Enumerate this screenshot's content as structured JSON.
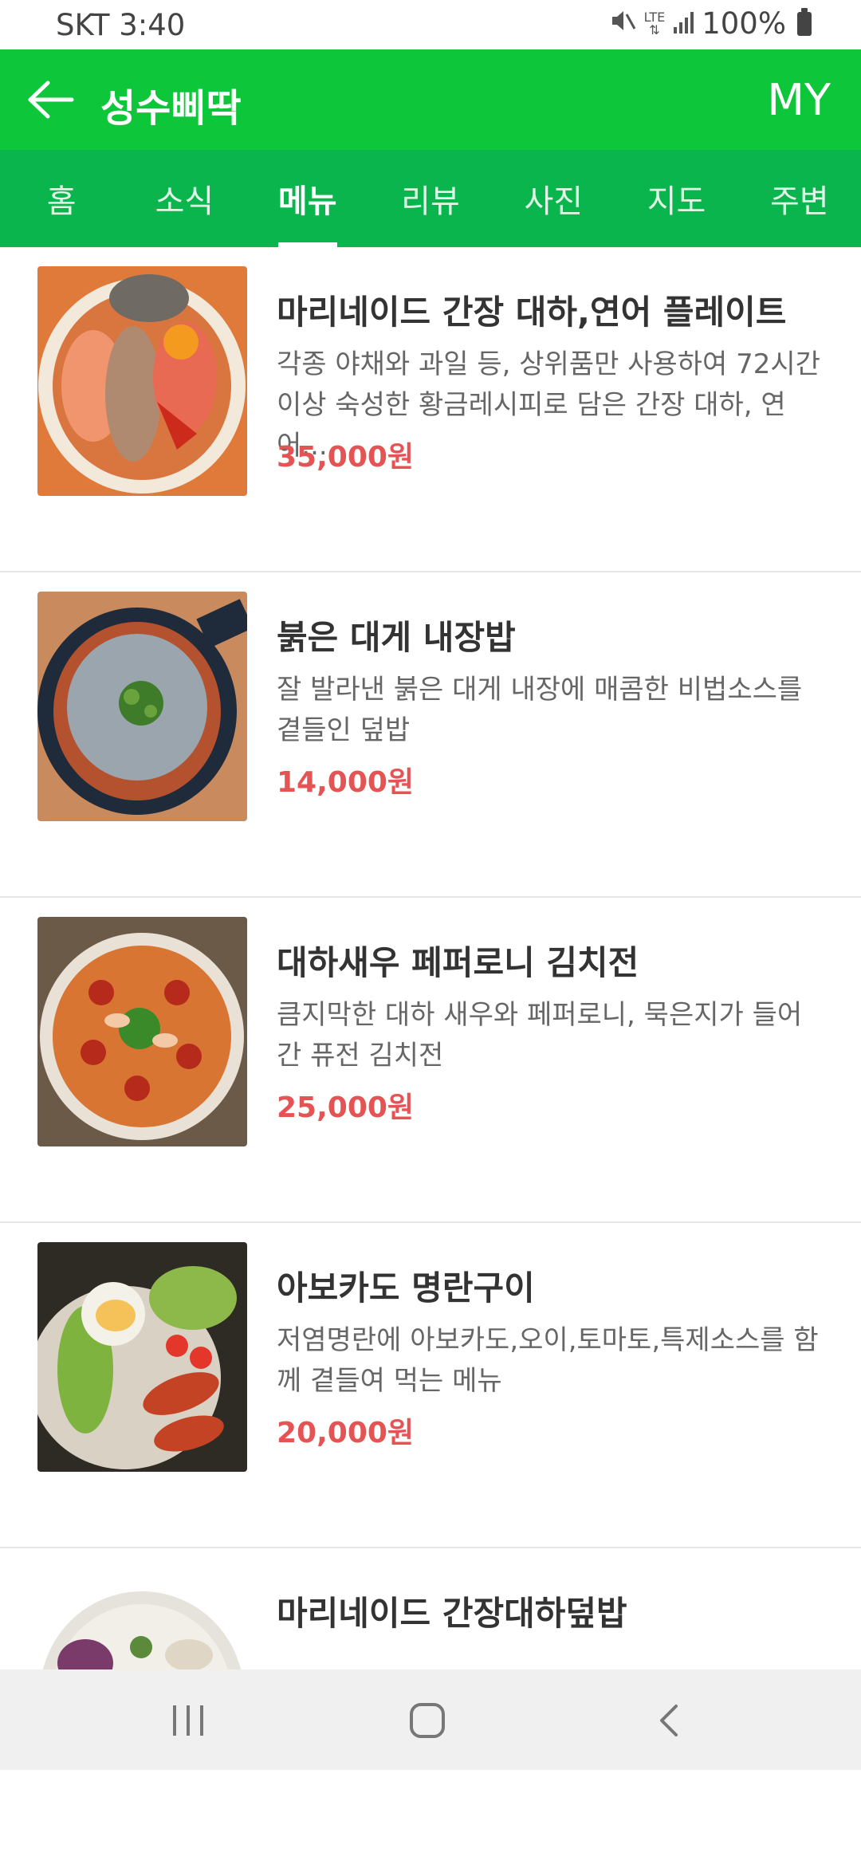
{
  "status": {
    "carrier_time": "SKT 3:40",
    "network": "LTE",
    "battery": "100%"
  },
  "header": {
    "title": "성수삐딱",
    "my_label": "MY"
  },
  "tabs": [
    {
      "label": "홈"
    },
    {
      "label": "소식"
    },
    {
      "label": "메뉴"
    },
    {
      "label": "리뷰"
    },
    {
      "label": "사진"
    },
    {
      "label": "지도"
    },
    {
      "label": "주변"
    }
  ],
  "active_tab": "메뉴",
  "menu": [
    {
      "title": "마리네이드 간장 대하,연어 플레이트",
      "desc": "각종 야채와 과일 등, 상위품만 사용하여 72시간 이상 숙성한 황금레시피로 담은 간장 대하, 연어...",
      "price": "35,000원"
    },
    {
      "title": "붉은 대게 내장밥",
      "desc": "잘 발라낸 붉은 대게 내장에 매콤한 비법소스를 곁들인 덮밥",
      "price": "14,000원"
    },
    {
      "title": "대하새우 페퍼로니 김치전",
      "desc": "큼지막한 대하 새우와 페퍼로니, 묵은지가 들어간 퓨전 김치전",
      "price": "25,000원"
    },
    {
      "title": "아보카도 명란구이",
      "desc": "저염명란에 아보카도,오이,토마토,특제소스를 함께 곁들여 먹는 메뉴",
      "price": "20,000원"
    },
    {
      "title": "마리네이드 간장대하덮밥",
      "desc": "",
      "price": ""
    }
  ],
  "colors": {
    "header_green": "#0ec63a",
    "tab_green": "#0bb54e",
    "price_red": "#e45454"
  },
  "icons": {
    "back": "back-arrow-icon",
    "recents": "recents-icon",
    "home": "home-icon",
    "nav_back": "nav-back-icon",
    "mute": "mute-icon",
    "signal": "signal-icon",
    "battery": "battery-icon"
  }
}
